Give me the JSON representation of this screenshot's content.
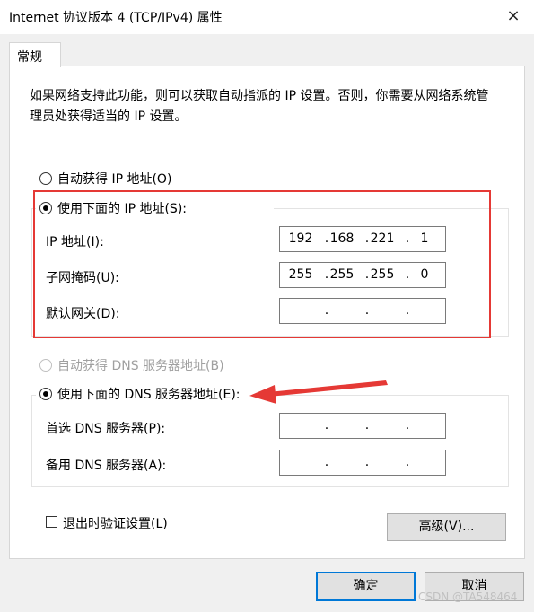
{
  "window": {
    "title": "Internet 协议版本 4 (TCP/IPv4) 属性",
    "close_icon": "×"
  },
  "tab": {
    "label": "常规"
  },
  "description": "如果网络支持此功能，则可以获取自动指派的 IP 设置。否则，你需要从网络系统管理员处获得适当的 IP 设置。",
  "ip_section": {
    "auto_label": "自动获得 IP 地址(O)",
    "manual_label": "使用下面的 IP 地址(S):",
    "selected": "manual",
    "fields": [
      {
        "label": "IP 地址(I):",
        "octets": [
          "192",
          "168",
          "221",
          "1"
        ]
      },
      {
        "label": "子网掩码(U):",
        "octets": [
          "255",
          "255",
          "255",
          "0"
        ]
      },
      {
        "label": "默认网关(D):",
        "octets": [
          "",
          "",
          "",
          ""
        ]
      }
    ]
  },
  "dns_section": {
    "auto_label": "自动获得 DNS 服务器地址(B)",
    "manual_label": "使用下面的 DNS 服务器地址(E):",
    "selected": "manual",
    "fields": [
      {
        "label": "首选 DNS 服务器(P):",
        "octets": [
          "",
          "",
          "",
          ""
        ]
      },
      {
        "label": "备用 DNS 服务器(A):",
        "octets": [
          "",
          "",
          "",
          ""
        ]
      }
    ]
  },
  "validate_checkbox": {
    "label": "退出时验证设置(L)",
    "checked": false
  },
  "buttons": {
    "advanced": "高级(V)...",
    "ok": "确定",
    "cancel": "取消"
  },
  "watermark": "CSDN @TA548464",
  "colors": {
    "highlight_box": "#e53935",
    "arrow": "#e53935",
    "primary_border": "#0078d7"
  }
}
